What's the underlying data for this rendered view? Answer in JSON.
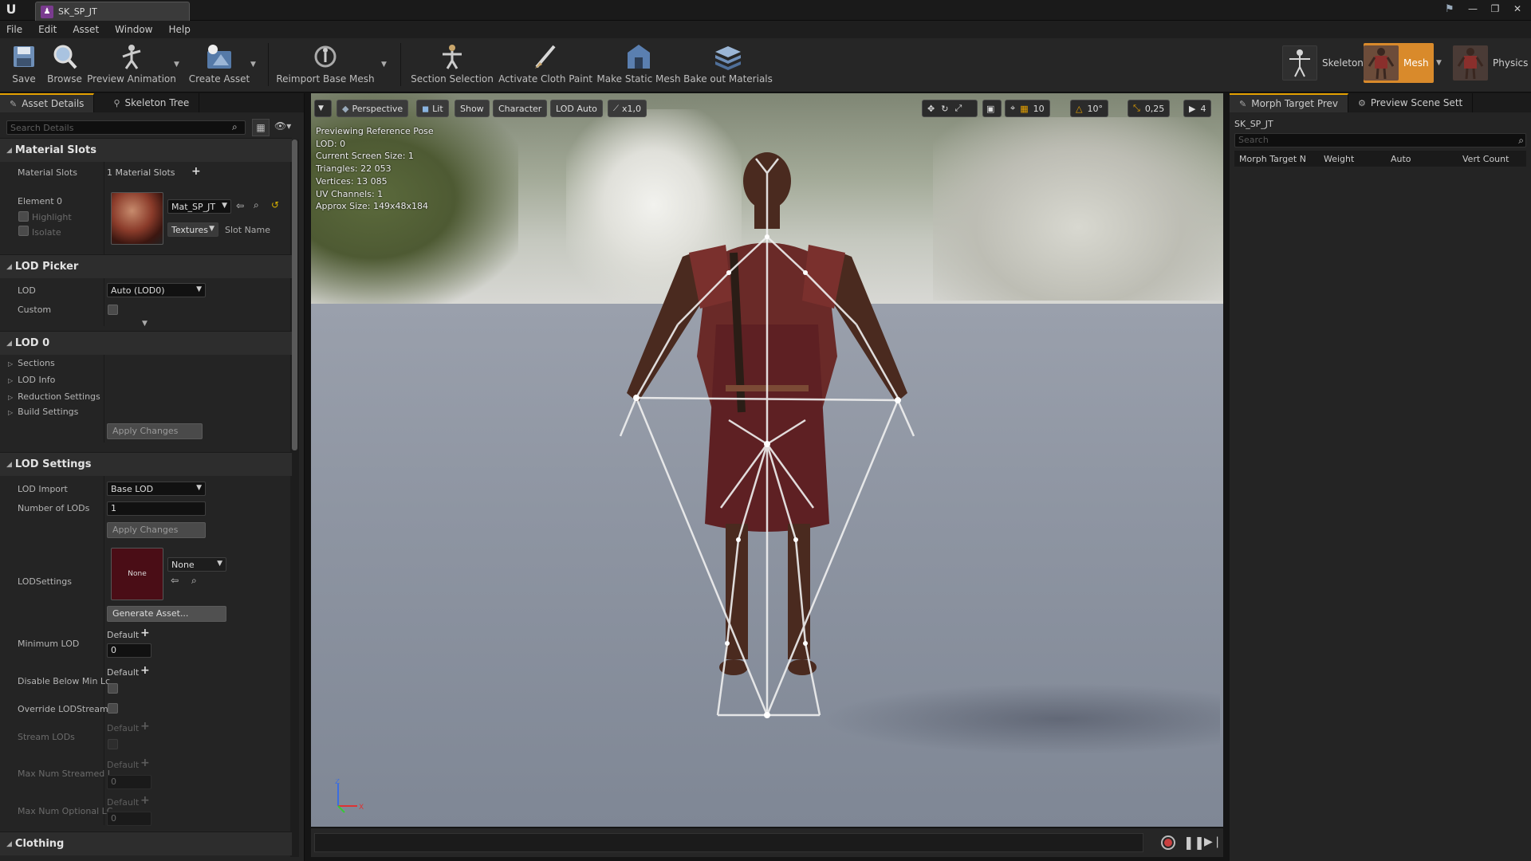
{
  "window": {
    "doc_tab": "SK_SP_JT",
    "controls": [
      "—",
      "❐",
      "✕"
    ]
  },
  "menu": [
    "File",
    "Edit",
    "Asset",
    "Window",
    "Help"
  ],
  "toolbar": {
    "buttons": [
      {
        "label": "Save",
        "icon": "save-icon"
      },
      {
        "label": "Browse",
        "icon": "browse-icon"
      },
      {
        "label": "Preview Animation",
        "icon": "preview-animation-icon"
      },
      {
        "label": "Create Asset",
        "icon": "create-asset-icon"
      },
      {
        "label": "Reimport Base Mesh",
        "icon": "reimport-icon"
      },
      {
        "label": "Section Selection",
        "icon": "section-selection-icon"
      },
      {
        "label": "Activate Cloth Paint",
        "icon": "cloth-paint-icon"
      },
      {
        "label": "Make Static Mesh",
        "icon": "static-mesh-icon"
      },
      {
        "label": "Bake out Materials",
        "icon": "bake-materials-icon"
      }
    ],
    "modes": [
      {
        "label": "Skeleton",
        "active": false
      },
      {
        "label": "Mesh",
        "active": true
      },
      {
        "label": "Physics",
        "active": false
      }
    ],
    "accent": "#e5a100"
  },
  "left_panel": {
    "tabs": [
      "Asset Details",
      "Skeleton Tree"
    ],
    "search_placeholder": "Search Details",
    "material_slots": {
      "header": "Material Slots",
      "label": "Material Slots",
      "count": "1 Material Slots",
      "element": "Element 0",
      "highlight": "Highlight",
      "isolate": "Isolate",
      "material": "Mat_SP_JT",
      "textures": "Textures",
      "slot_name": "Slot Name"
    },
    "lod_picker": {
      "header": "LOD Picker",
      "lod_label": "LOD",
      "lod_value": "Auto (LOD0)",
      "custom_label": "Custom"
    },
    "lod0": {
      "header": "LOD 0",
      "items": [
        "Sections",
        "LOD Info",
        "Reduction Settings",
        "Build Settings"
      ],
      "apply": "Apply Changes"
    },
    "lod_settings": {
      "header": "LOD Settings",
      "lod_import_label": "LOD Import",
      "lod_import_value": "Base LOD",
      "num_lods_label": "Number of LODs",
      "num_lods_value": "1",
      "apply": "Apply Changes",
      "lodsettings_label": "LODSettings",
      "lodsettings_thumb": "None",
      "lodsettings_value": "None",
      "generate": "Generate Asset...",
      "min_lod_label": "Minimum LOD",
      "min_lod_default": "Default",
      "min_lod_value": "0",
      "disable_below_label": "Disable Below Min Lc",
      "disable_below_default": "Default",
      "override_label": "Override LODStreami",
      "stream_lods_label": "Stream LODs",
      "stream_lods_default": "Default",
      "max_streamed_label": "Max Num Streamed I",
      "max_streamed_default": "Default",
      "max_streamed_value": "0",
      "max_optional_label": "Max Num Optional LC",
      "max_optional_default": "Default",
      "max_optional_value": "0"
    },
    "clothing": {
      "header": "Clothing"
    }
  },
  "viewport": {
    "toolbar": {
      "perspective": "Perspective",
      "lit": "Lit",
      "show": "Show",
      "character": "Character",
      "lod": "LOD Auto",
      "speed": "x1,0",
      "grid_snap": "10",
      "rot_snap": "10°",
      "scale_snap": "0,25",
      "cam_speed": "4"
    },
    "info": [
      "Previewing Reference Pose",
      "LOD: 0",
      "Current Screen Size: 1",
      "Triangles: 22 053",
      "Vertices: 13 085",
      "UV Channels: 1",
      "Approx Size: 149x48x184"
    ],
    "axis": {
      "z": "Z",
      "x": "X"
    }
  },
  "right_panel": {
    "tabs": [
      "Morph Target Prev",
      "Preview Scene Sett"
    ],
    "asset": "SK_SP_JT",
    "search_placeholder": "Search",
    "columns": [
      "Morph Target N",
      "Weight",
      "Auto",
      "Vert Count"
    ]
  }
}
